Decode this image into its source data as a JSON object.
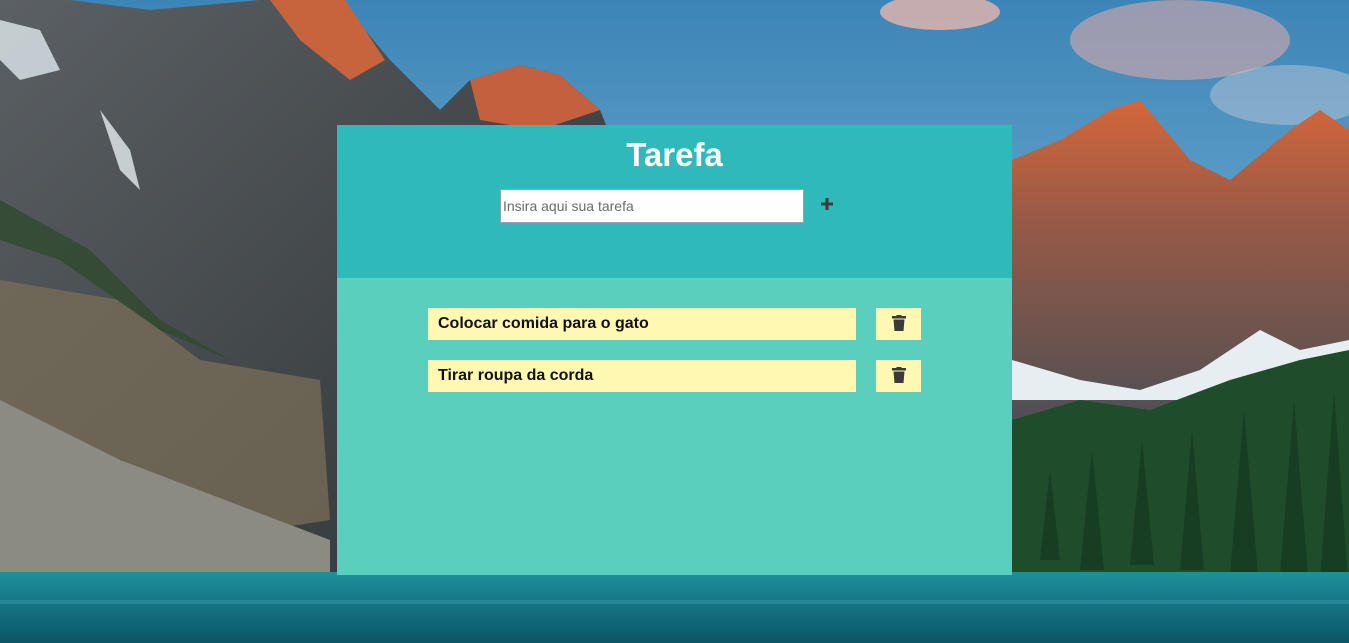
{
  "header": {
    "title": "Tarefa"
  },
  "new_task": {
    "placeholder": "Insira aqui sua tarefa",
    "add_icon": "plus-icon"
  },
  "tasks": [
    {
      "text": "Colocar comida para o gato",
      "delete_icon": "trash-icon"
    },
    {
      "text": "Tirar roupa da corda",
      "delete_icon": "trash-icon"
    }
  ],
  "colors": {
    "header_bg": "#30b9ba",
    "body_bg": "#5bcfbe",
    "task_bg": "#fff8b2",
    "title_text": "#ffffff",
    "icon": "#3a3a3a"
  },
  "background": "mountain-lake-landscape"
}
